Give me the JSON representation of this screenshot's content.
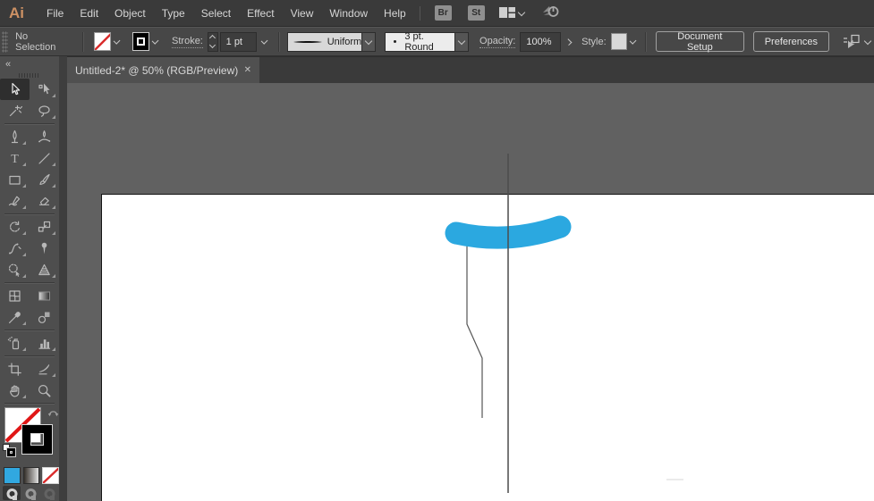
{
  "app": {
    "logo": "Ai",
    "name": "Adobe Illustrator"
  },
  "menubar": {
    "items": [
      "File",
      "Edit",
      "Object",
      "Type",
      "Select",
      "Effect",
      "View",
      "Window",
      "Help"
    ],
    "bridge": "Br",
    "stock": "St",
    "icons": [
      "workspace-switcher-icon",
      "share-rocket-icon"
    ]
  },
  "controlbar": {
    "selection_status": "No Selection",
    "fill_swatch": "none",
    "stroke_swatch": "black",
    "stroke_label": "Stroke:",
    "stroke_value": "1 pt",
    "width_profile": "Uniform",
    "brush": "3 pt. Round",
    "opacity_label": "Opacity:",
    "opacity_value": "100%",
    "style_label": "Style:",
    "document_setup": "Document Setup",
    "preferences": "Preferences"
  },
  "tabbar": {
    "title": "Untitled-2* @ 50% (RGB/Preview)",
    "close": "✕"
  },
  "toolbar": {
    "collapse": "«",
    "type_tool_glyph": "T",
    "selected_tool": "selection-tool",
    "tools": [
      "selection-tool",
      "direct-selection-tool",
      "magic-wand-tool",
      "lasso-tool",
      "pen-tool",
      "curvature-tool",
      "type-tool",
      "line-segment-tool",
      "rectangle-tool",
      "paintbrush-tool",
      "shaper-tool",
      "eraser-tool",
      "rotate-tool",
      "scale-tool",
      "width-tool",
      "puppet-warp-tool",
      "shape-builder-tool",
      "perspective-grid-tool",
      "mesh-tool",
      "gradient-tool",
      "eyedropper-tool",
      "blend-tool",
      "symbol-sprayer-tool",
      "column-graph-tool",
      "artboard-tool",
      "slice-tool",
      "hand-tool",
      "zoom-tool"
    ],
    "fill": "none",
    "stroke": "black",
    "color_swatches": [
      "color-blue",
      "gradient",
      "none-selected"
    ],
    "drawing_modes": [
      "draw-normal-selected",
      "draw-behind",
      "draw-inside"
    ]
  },
  "artwork": {
    "objects": [
      "curved-brush-stroke",
      "vertical-path-line",
      "bent-path-line"
    ],
    "brush_stroke_color": "#2BA8E0"
  },
  "colors": {
    "accent_blue": "#2BA8E0",
    "none_red": "#d92b2b",
    "canvas_gray": "#616161",
    "ui_dark": "#3a3a3a"
  }
}
